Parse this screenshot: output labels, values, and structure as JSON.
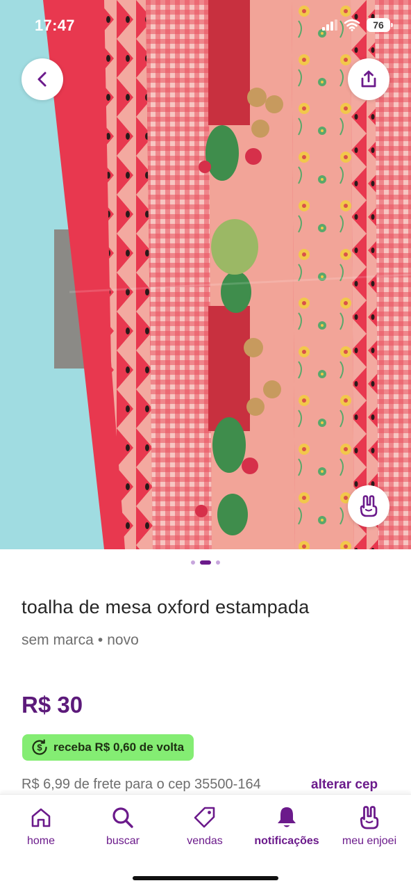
{
  "status_bar": {
    "time": "17:47",
    "battery": "76"
  },
  "product": {
    "title": "toalha de mesa oxford estampada",
    "brand": "sem marca",
    "separator": "•",
    "condition": "novo",
    "price": "R$ 30",
    "cashback": "receba R$ 0,60 de volta",
    "shipping": "R$ 6,99 de frete para o cep 35500-164",
    "change_cep": "alterar cep"
  },
  "carousel": {
    "total": 3,
    "active_index": 1
  },
  "bottom_nav": [
    {
      "label": "home",
      "icon": "home-icon"
    },
    {
      "label": "buscar",
      "icon": "search-icon"
    },
    {
      "label": "vendas",
      "icon": "price-tag-icon"
    },
    {
      "label": "notificações",
      "icon": "bell-icon",
      "active": true
    },
    {
      "label": "meu enjoei",
      "icon": "rock-hand-icon"
    }
  ],
  "colors": {
    "brand_purple": "#6b1a8b",
    "price_purple": "#5c1a7a",
    "cashback_green": "#84ed73",
    "tablecloth_red": "#e8384f",
    "tablecloth_pink": "#f0a79a"
  }
}
